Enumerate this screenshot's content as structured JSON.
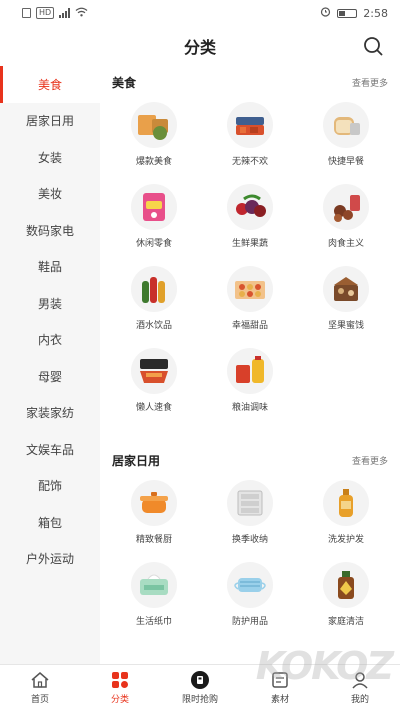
{
  "status_bar": {
    "network": "HD",
    "time": "2:58",
    "icons": [
      "sim-icon",
      "signal-icon",
      "wifi-icon",
      "alarm-icon",
      "battery-icon"
    ]
  },
  "header": {
    "title": "分类",
    "search_icon": "search-icon"
  },
  "sidebar": {
    "items": [
      {
        "label": "美食",
        "active": true
      },
      {
        "label": "居家日用"
      },
      {
        "label": "女装"
      },
      {
        "label": "美妆"
      },
      {
        "label": "数码家电"
      },
      {
        "label": "鞋品"
      },
      {
        "label": "男装"
      },
      {
        "label": "内衣"
      },
      {
        "label": "母婴"
      },
      {
        "label": "家装家纺"
      },
      {
        "label": "文娱车品"
      },
      {
        "label": "配饰"
      },
      {
        "label": "箱包"
      },
      {
        "label": "户外运动"
      }
    ]
  },
  "sections": [
    {
      "title": "美食",
      "more": "查看更多",
      "items": [
        {
          "label": "爆款美食",
          "icon": "snack-food-icon"
        },
        {
          "label": "无辣不欢",
          "icon": "spicy-meat-icon"
        },
        {
          "label": "快捷早餐",
          "icon": "bread-icon"
        },
        {
          "label": "休闲零食",
          "icon": "snack-bag-icon"
        },
        {
          "label": "生鲜果蔬",
          "icon": "fruit-icon"
        },
        {
          "label": "肉食主义",
          "icon": "meat-icon"
        },
        {
          "label": "酒水饮品",
          "icon": "drinks-icon"
        },
        {
          "label": "幸福甜品",
          "icon": "dessert-icon"
        },
        {
          "label": "坚果蜜饯",
          "icon": "nuts-icon"
        },
        {
          "label": "懒人速食",
          "icon": "instant-food-icon"
        },
        {
          "label": "粮油调味",
          "icon": "cooking-oil-icon"
        }
      ]
    },
    {
      "title": "居家日用",
      "more": "查看更多",
      "items": [
        {
          "label": "精致餐厨",
          "icon": "pot-icon"
        },
        {
          "label": "换季收纳",
          "icon": "storage-box-icon"
        },
        {
          "label": "洗发护发",
          "icon": "shampoo-icon"
        },
        {
          "label": "生活纸巾",
          "icon": "tissue-icon"
        },
        {
          "label": "防护用品",
          "icon": "mask-icon"
        },
        {
          "label": "家庭清洁",
          "icon": "disinfectant-icon"
        }
      ]
    }
  ],
  "tabbar": {
    "items": [
      {
        "label": "首页",
        "icon": "home-icon"
      },
      {
        "label": "分类",
        "icon": "category-icon",
        "active": true
      },
      {
        "label": "限时抢购",
        "icon": "flash-sale-icon"
      },
      {
        "label": "素材",
        "icon": "material-icon"
      },
      {
        "label": "我的",
        "icon": "profile-icon"
      }
    ]
  },
  "watermark": "KOKOZ"
}
